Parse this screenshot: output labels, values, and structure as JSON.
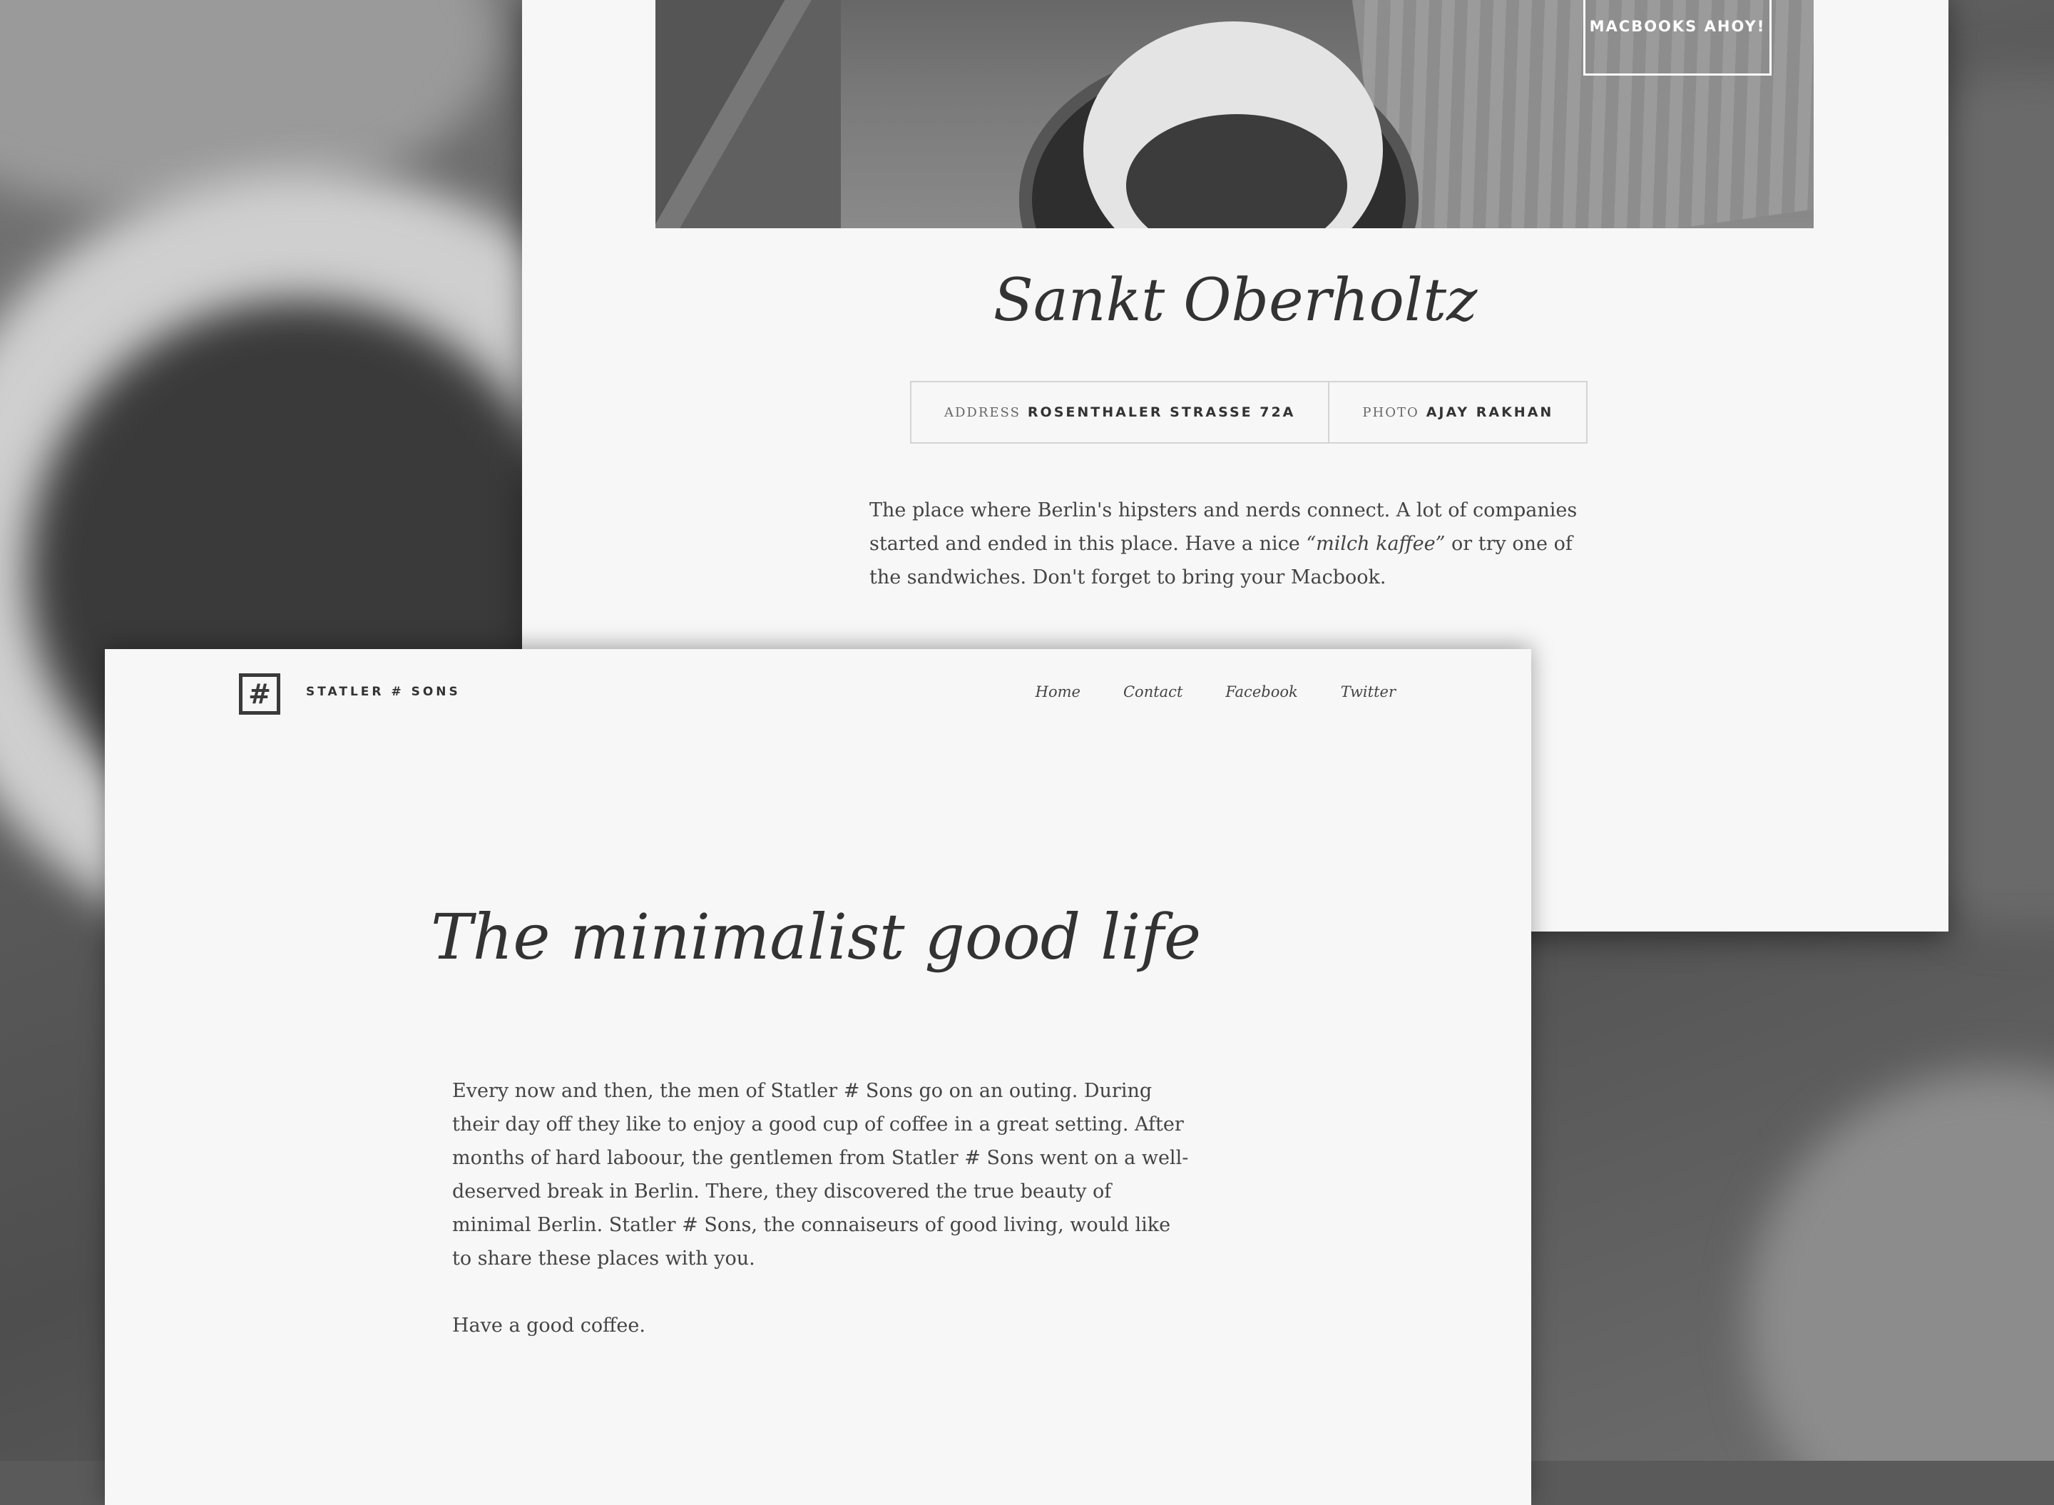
{
  "detail_page": {
    "hero_button": "MACBOOKS AHOY!",
    "title": "Sankt Oberholtz",
    "meta": [
      {
        "key": "ADDRESS",
        "value": "ROSENTHALER STRAßE 72A"
      },
      {
        "key": "PHOTO",
        "value": "AJAY RAKHAN"
      }
    ],
    "description": {
      "part1": "The place where Berlin's hipsters and nerds connect. A lot of companies started and ended in this place. Have a nice ",
      "emphasis": "“milch kaffee”",
      "part2": " or try one of the sandwiches. Don't forget to bring your Macbook."
    }
  },
  "home_page": {
    "logo_glyph": "#",
    "brand": "STATLER # SONS",
    "nav": [
      "Home",
      "Contact",
      "Facebook",
      "Twitter"
    ],
    "title": "The minimalist good life",
    "paragraphs": [
      "Every now and then, the men of Statler # Sons go on an outing. During their day off they like to enjoy a good cup of coffee in a great setting. After months of hard laboour, the gentlemen from Statler # Sons went on a well-deserved break in Berlin. There, they discovered the true beauty of minimal Berlin. Statler # Sons, the connaiseurs of good living, would like to share these places with you.",
      "Have a good coffee."
    ]
  },
  "colors": {
    "background": "#5a5a5a",
    "card": "#f7f7f7",
    "text": "#333333"
  }
}
